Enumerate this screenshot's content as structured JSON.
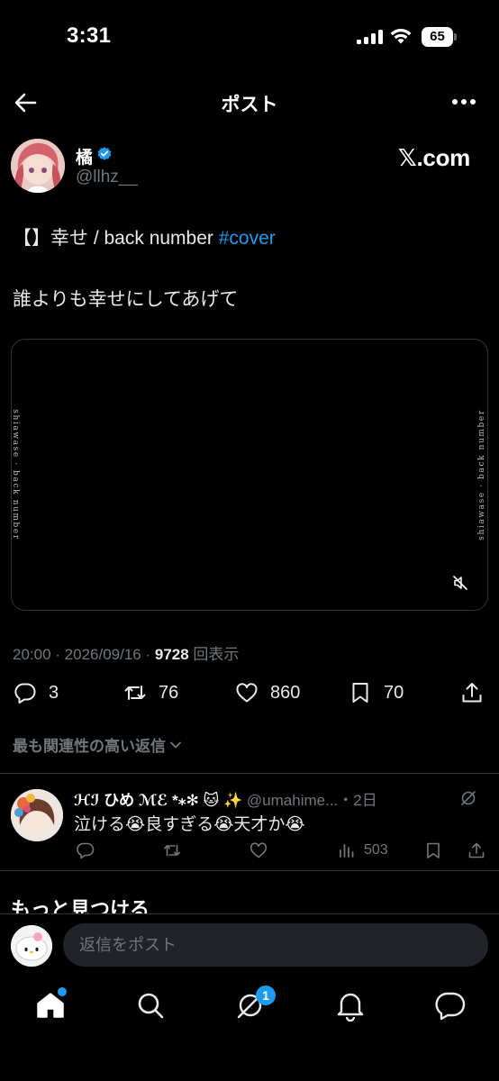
{
  "status": {
    "time": "3:31",
    "battery": "65"
  },
  "nav": {
    "title": "ポスト"
  },
  "author": {
    "name": "橘",
    "handle": "@llhz__",
    "brand": "𝕏.com"
  },
  "post": {
    "line1_prefix": "【】幸せ / back number ",
    "hashtag": "#cover",
    "line2": "誰よりも幸せにしてあげて",
    "video_side_text": "shiawase · back number",
    "time": "20:00",
    "date": "2026/09/16",
    "views_count": "9728",
    "views_label": "回表示"
  },
  "actions": {
    "replies": "3",
    "reposts": "76",
    "likes": "860",
    "bookmarks": "70"
  },
  "sort_label": "最も関連性の高い返信",
  "reply": {
    "name": "ℋℐ ひめ ℳℰ *⁎✻ 🐱 ✨",
    "handle": "@umahime...",
    "age": "・2日",
    "text": "泣ける😭良すぎる😭天才か😭",
    "views": "503"
  },
  "section_title": "もっと見つける",
  "composer": {
    "placeholder": "返信をポスト"
  },
  "tabs": {
    "messages_badge": "1"
  },
  "colors": {
    "accent": "#1d9bf0",
    "background": "#000000",
    "muted": "#71767b",
    "divider": "#2f3336"
  }
}
